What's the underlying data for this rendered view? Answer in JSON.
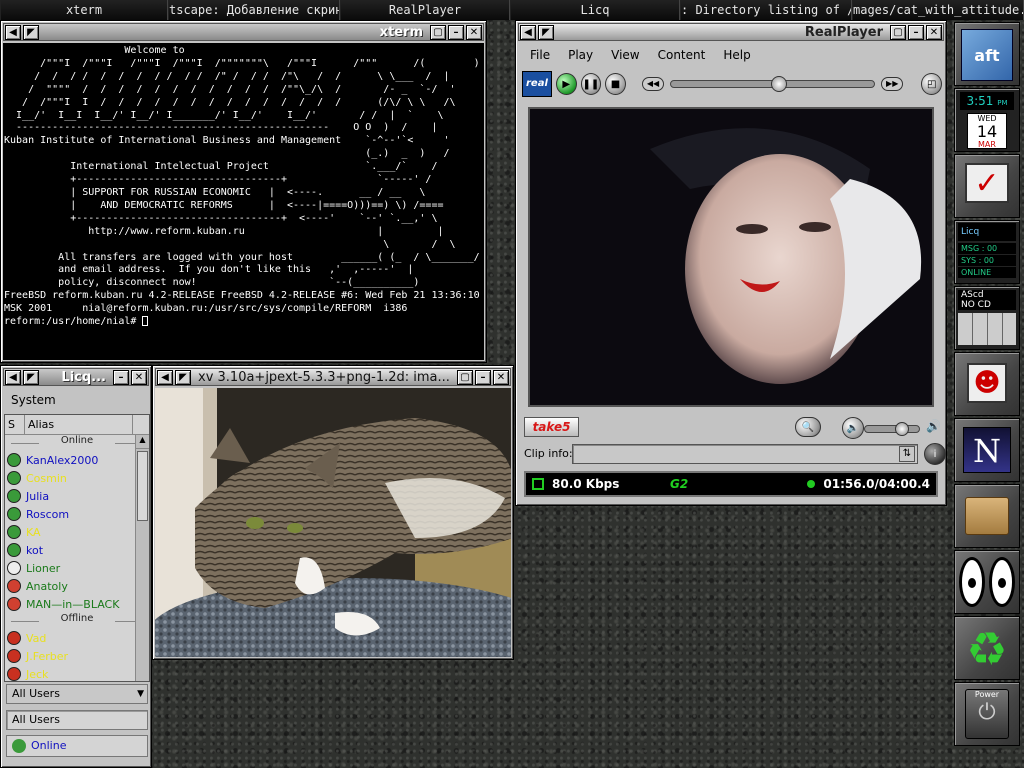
{
  "pager": {
    "tasks": [
      {
        "label": "xterm",
        "w": 168
      },
      {
        "label": "tscape: Добавление скриншо",
        "w": 172
      },
      {
        "label": "RealPlayer",
        "w": 170
      },
      {
        "label": "Licq",
        "w": 170
      },
      {
        "label": ": Directory listing of /roo",
        "w": 172
      },
      {
        "label": "mages/cat_with_attitude.jp",
        "w": 172
      }
    ]
  },
  "xterm": {
    "title": "xterm",
    "lines": [
      "                    Welcome to",
      "      /\"\"\"I  /\"\"\"I   /\"\"\"I  /\"\"\"I  /\"\"\"\"\"\"\"\\   /\"\"\"I      /\"\"\"      /(        ) `",
      "     /  /  / /  /  /  /  / /  / /  /\" /  / /  /\"\\   /  /      \\ \\___  /  |",
      "    /  \"\"\"\"  /  /  /  /  /  /  /  /  /  /  /  /\"\"\\_/\\  /       /- _  `-/  '",
      "   /  /\"\"\"I  I  /  /  /  /  /  /  /  /  /  /  /  /  /  /      (/\\/ \\ \\   /\\",
      "  I__/'  I__I  I__/' I__/' I_______/' I__/'    I__/'       / /  |  `    \\",
      "  ----------------------------------------------------    O O  )  /    |",
      "Kuban Institute of International Business and Management    `-^--'`<     '",
      "                                                            (_.)  _  )   /",
      "           International Intelectual Project                `.___/`    /",
      "           +----------------------------------+               `-----' /",
      "           | SUPPORT FOR RUSSIAN ECONOMIC   |  <----.      __ / __   \\",
      "           |    AND DEMOCRATIC REFORMS      |  <----|====O)))==) \\) /====",
      "           +----------------------------------+  <----'    `--' `.__,' \\",
      "              http://www.reform.kuban.ru                      |         |",
      "                                                               \\       /  \\",
      "         All transfers are logged with your host        ______( (_  / \\_______/",
      "         and email address.  If you don't like this   ,'  ,-----'  |",
      "         policy, disconnect now!                      `--(__________)",
      "",
      "FreeBSD reform.kuban.ru 4.2-RELEASE FreeBSD 4.2-RELEASE #6: Wed Feb 21 13:36:10",
      "MSK 2001     nial@reform.kuban.ru:/usr/src/sys/compile/REFORM  i386",
      "reform:/usr/home/nial# "
    ]
  },
  "licq": {
    "title": "Licq...",
    "menu": "System",
    "col_s": "S",
    "col_alias": "Alias",
    "online_label": "Online",
    "offline_label": "Offline",
    "online": [
      {
        "name": "KanAlex2000",
        "color": "#1010c0",
        "icon": "#3a9a3a"
      },
      {
        "name": "Cosmin",
        "color": "#e8e020",
        "icon": "#3a9a3a"
      },
      {
        "name": "Julia",
        "color": "#1010c0",
        "icon": "#3a9a3a"
      },
      {
        "name": "Roscom",
        "color": "#1010c0",
        "icon": "#3a9a3a"
      },
      {
        "name": "KA",
        "color": "#e8e020",
        "icon": "#3a9a3a"
      },
      {
        "name": "kot",
        "color": "#1010c0",
        "icon": "#3a9a3a"
      },
      {
        "name": "Lioner",
        "color": "#1a7a1a",
        "icon": "#eeeeee"
      },
      {
        "name": "Anatoly",
        "color": "#1a7a1a",
        "icon": "#d04030"
      },
      {
        "name": "MAN—in—BLACK",
        "color": "#1a7a1a",
        "icon": "#d04030"
      }
    ],
    "offline": [
      {
        "name": "Vad",
        "color": "#e8e020",
        "icon": "#c83020"
      },
      {
        "name": "J.Ferber",
        "color": "#e8e020",
        "icon": "#c83020"
      },
      {
        "name": "Jeck",
        "color": "#e8e020",
        "icon": "#c83020"
      }
    ],
    "group_select": "All Users",
    "group_box": "All Users",
    "status": "Online"
  },
  "xv": {
    "title": "xv 3.10a+jpext-5.3.3+png-1.2d: ima..."
  },
  "realplayer": {
    "title": "RealPlayer",
    "menu": [
      "File",
      "Play",
      "View",
      "Content",
      "Help"
    ],
    "logo": "real",
    "brand": "take5",
    "clip_label": "Clip info:",
    "bitrate": "80.0 Kbps",
    "g2": "G2",
    "time": "01:56.0/04:00.4"
  },
  "dock": {
    "clock_time": "3:51",
    "clock_ampm": "PM",
    "day": "WED",
    "date": "14",
    "month": "MAR",
    "licq_label": "Licq",
    "msg": "MSG : 00",
    "sys": "SYS : 00",
    "online": "ONLINE",
    "cd_label": "AScd",
    "cd_status": "NO CD",
    "power": "Power",
    "n": "N"
  }
}
